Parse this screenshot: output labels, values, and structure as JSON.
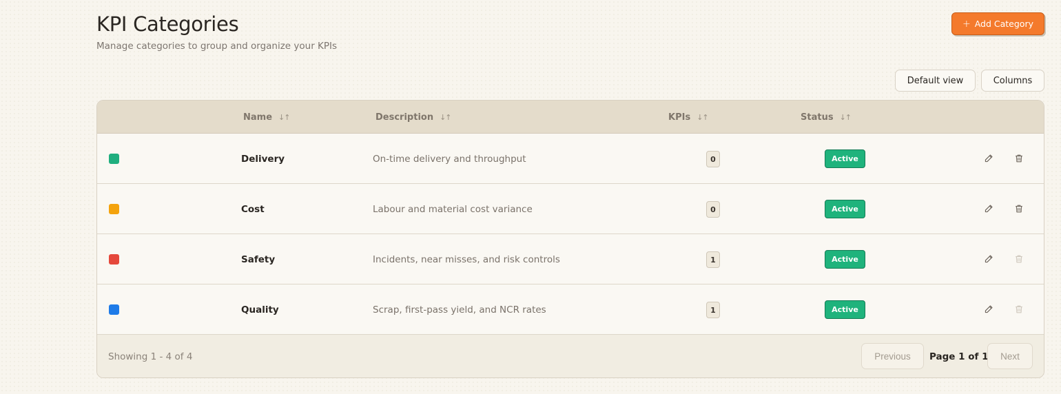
{
  "header": {
    "title": "KPI Categories",
    "subtitle": "Manage categories to group and organize your KPIs",
    "add_button_label": "Add Category"
  },
  "toolbar": {
    "default_view_label": "Default view",
    "columns_label": "Columns"
  },
  "table": {
    "columns": {
      "name": "Name",
      "description": "Description",
      "kpis": "KPIs",
      "status": "Status"
    },
    "rows": [
      {
        "color": "#1fae7e",
        "name": "Delivery",
        "description": "On-time delivery and throughput",
        "kpis": "0",
        "status": "Active",
        "delete_enabled": true
      },
      {
        "color": "#f4a30c",
        "name": "Cost",
        "description": "Labour and material cost variance",
        "kpis": "0",
        "status": "Active",
        "delete_enabled": true
      },
      {
        "color": "#e5483b",
        "name": "Safety",
        "description": "Incidents, near misses, and risk controls",
        "kpis": "1",
        "status": "Active",
        "delete_enabled": false
      },
      {
        "color": "#1e7be8",
        "name": "Quality",
        "description": "Scrap, first-pass yield, and NCR rates",
        "kpis": "1",
        "status": "Active",
        "delete_enabled": false
      }
    ]
  },
  "footer": {
    "showing": "Showing 1 - 4 of 4",
    "previous_label": "Previous",
    "page_info": "Page 1 of 1",
    "next_label": "Next"
  },
  "icons": {
    "add": "plus-icon",
    "sort": "sort-icon",
    "edit": "pencil-icon",
    "delete": "trash-icon"
  }
}
